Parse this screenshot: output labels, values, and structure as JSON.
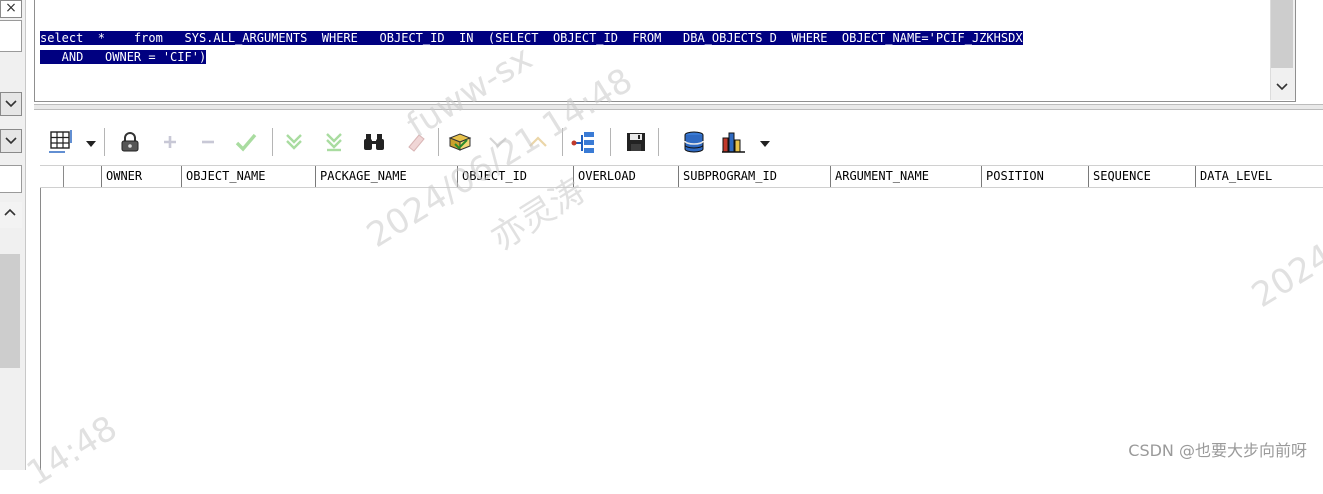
{
  "editor": {
    "sql_line1": "select  *    from   SYS.ALL_ARGUMENTS  WHERE   OBJECT_ID  IN  (SELECT  OBJECT_ID  FROM   DBA_OBJECTS D  WHERE  OBJECT_NAME='PCIF_JZKHSDX",
    "sql_line2": "   AND   OWNER = 'CIF')"
  },
  "left_panel": {
    "close_glyph": "×"
  },
  "toolbar": {
    "icons": [
      "grid-select-icon",
      "lock-icon",
      "plus-icon",
      "minus-icon",
      "check-icon",
      "arrow-down-icon",
      "arrow-down-last-icon",
      "binoculars-icon",
      "eraser-icon",
      "export-icon",
      "filter-down-icon",
      "filter-up-icon",
      "tree-icon",
      "save-icon",
      "database-icon",
      "bar-chart-icon"
    ]
  },
  "grid": {
    "columns": [
      "OWNER",
      "OBJECT_NAME",
      "PACKAGE_NAME",
      "OBJECT_ID",
      "OVERLOAD",
      "SUBPROGRAM_ID",
      "ARGUMENT_NAME",
      "POSITION",
      "SEQUENCE",
      "DATA_LEVEL"
    ],
    "rows": []
  },
  "watermark": {
    "user": "fuww-sx",
    "date": "2024/06/21 14:48",
    "name": "亦灵涛",
    "time_tail": "14:48",
    "year": "2024"
  },
  "attribution": "CSDN @也要大步向前呀",
  "colors": {
    "selection_bg": "#000080",
    "selection_text": "#ffffff",
    "toolbar_green": "#5bbf3a",
    "toolbar_red": "#c0392b"
  }
}
